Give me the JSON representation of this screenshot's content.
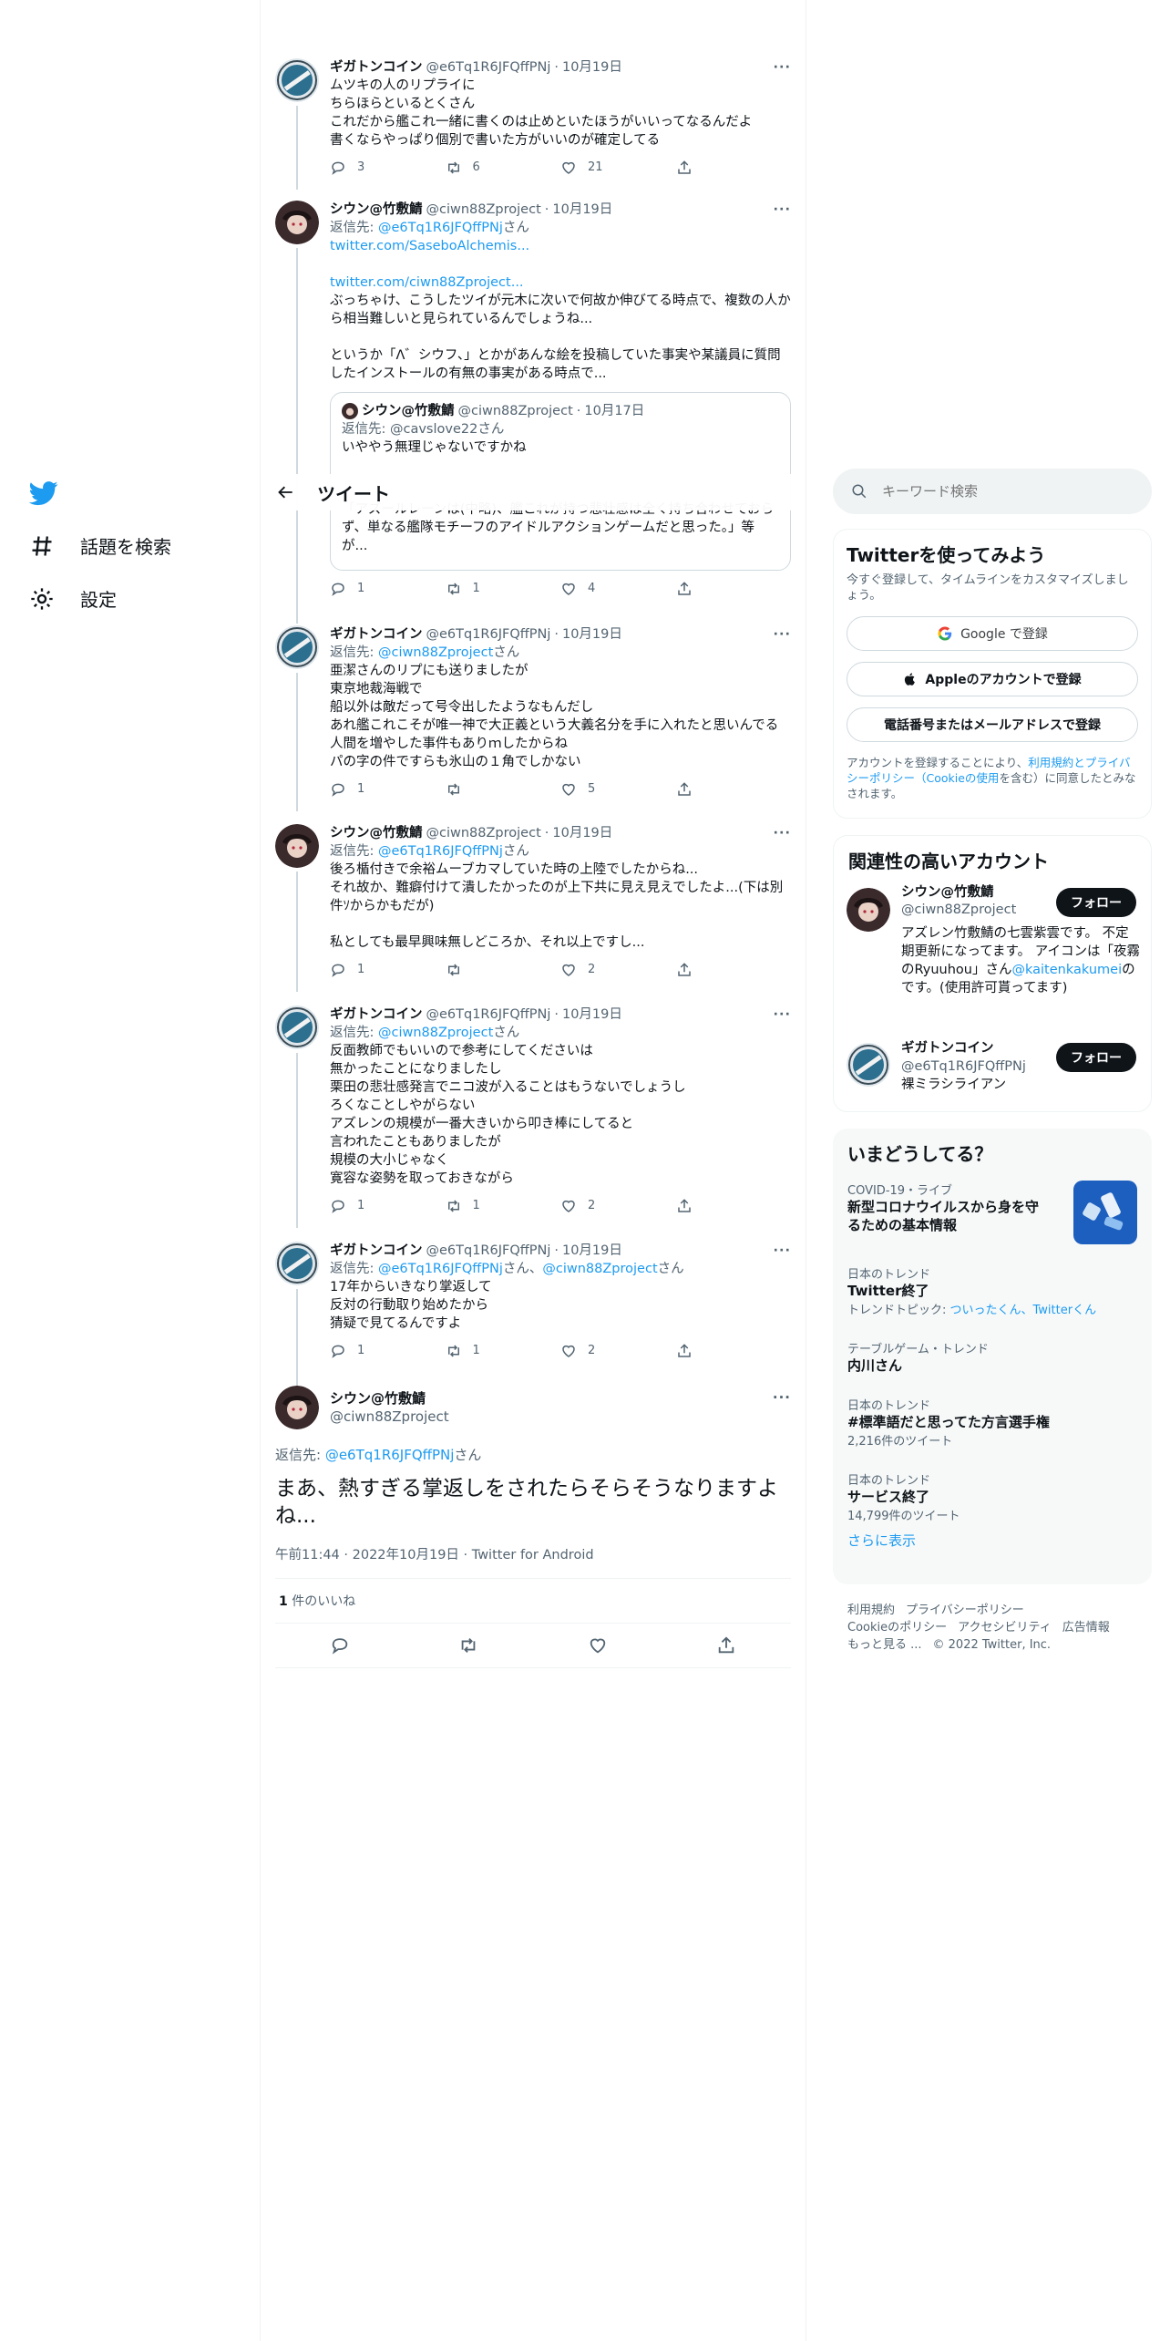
{
  "nav": {
    "explore_label": "話題を検索",
    "settings_label": "設定"
  },
  "header": {
    "title": "ツイート"
  },
  "tweets": [
    {
      "name": "ギガトンコイン",
      "handle": "@e6Tq1R6JFQffPNj",
      "date": "10月19日",
      "reply_to": "",
      "text": "ムツキの人のリプライに\nちらほらといるとくさん\nこれだから艦これ一緒に書くのは止めといたほうがいいってなるんだよ\n書くならやっぱり個別で書いた方がいいのが確定してる",
      "replies": "3",
      "retweets": "6",
      "likes": "21"
    },
    {
      "name": "シウン@竹敷鯖",
      "handle": "@ciwn88Zproject",
      "date": "10月19日",
      "reply_prefix": "返信先: ",
      "reply_to": "@e6Tq1R6JFQffPNj",
      "reply_suffix": "さん",
      "link1": "twitter.com/SaseboAlchemis...",
      "link2": "twitter.com/ciwn88Zproject...",
      "text": "ぶっちゃけ、こうしたツイが元木に次いで何故か伸びてる時点で、複数の人から相当難しいと見られているんでしょうね...\n\nというか「Λ゛シウフ、」とかがあんな絵を投稿していた事実や某議員に質問したインストールの有無の事実がある時点で...",
      "quote": {
        "name": "シウン@竹敷鯖",
        "handle": "@ciwn88Zproject",
        "date": "10月17日",
        "reply": "返信先: @cavslove22さん",
        "text_top": "いややう無理じゃないですかね",
        "text_bottom": "「アズールレーンは(中略)、艦これが持つ悲壮感は全く持ち合わせておらず、単なる艦隊モチーフのアイドルアクションゲームだと思った。」等が..."
      },
      "replies": "1",
      "retweets": "1",
      "likes": "4"
    },
    {
      "name": "ギガトンコイン",
      "handle": "@e6Tq1R6JFQffPNj",
      "date": "10月19日",
      "reply_prefix": "返信先: ",
      "reply_to": "@ciwn88Zproject",
      "reply_suffix": "さん",
      "text": "亜潔さんのリプにも送りましたが\n東京地裁海戦で\n船以外は敵だって号令出したようなもんだし\nあれ艦これこそが唯一神で大正義という大義名分を手に入れたと思いんでる人間を増やした事件もありｍしたからね\nパの字の件ですらも氷山の１角でしかない",
      "replies": "1",
      "retweets": "",
      "likes": "5"
    },
    {
      "name": "シウン@竹敷鯖",
      "handle": "@ciwn88Zproject",
      "date": "10月19日",
      "reply_prefix": "返信先: ",
      "reply_to": "@e6Tq1R6JFQffPNj",
      "reply_suffix": "さん",
      "text": "後ろ楯付きで余裕ムーブカマしていた時の上陸でしたからね...\nそれ故か、難癖付けて潰したかったのが上下共に見え見えでしたよ...(下は別件ｿからかもだが)\n\n私としても最早興味無しどころか、それ以上ですし...",
      "replies": "1",
      "retweets": "",
      "likes": "2"
    },
    {
      "name": "ギガトンコイン",
      "handle": "@e6Tq1R6JFQffPNj",
      "date": "10月19日",
      "reply_prefix": "返信先: ",
      "reply_to": "@ciwn88Zproject",
      "reply_suffix": "さん",
      "text": "反面教師でもいいので参考にしてくださいは\n無かったことになりましたし\n栗田の悲壮感発言でニコ波が入ることはもうないでしょうし\nろくなことしやがらない\nアズレンの規模が一番大きいから叩き棒にしてると\n言われたこともありましたが\n規模の大小じゃなく\n寛容な姿勢を取っておきながら",
      "replies": "1",
      "retweets": "1",
      "likes": "2"
    },
    {
      "name": "ギガトンコイン",
      "handle": "@e6Tq1R6JFQffPNj",
      "date": "10月19日",
      "reply_prefix": "返信先: ",
      "reply_to": "@e6Tq1R6JFQffPNj",
      "reply_and": "さん、",
      "reply_to2": "@ciwn88Zproject",
      "reply_suffix": "さん",
      "text": "17年からいきなり掌返して\n反対の行動取り始めたから\n猜疑で見てるんですよ",
      "replies": "1",
      "retweets": "1",
      "likes": "2"
    }
  ],
  "main_tweet": {
    "name": "シウン@竹敷鯖",
    "handle": "@ciwn88Zproject",
    "reply_prefix": "返信先: ",
    "reply_to": "@e6Tq1R6JFQffPNj",
    "reply_suffix": "さん",
    "text": "まあ、熱すぎる掌返しをされたらそらそうなりますよね...",
    "timestamp": "午前11:44 · 2022年10月19日 · Twitter for Android",
    "like_count": "1",
    "like_label": "件のいいね"
  },
  "search": {
    "placeholder": "キーワード検索"
  },
  "signup": {
    "title": "Twitterを使ってみよう",
    "subtitle": "今すぐ登録して、タイムラインをカスタマイズしましょう。",
    "google": "Google で登録",
    "apple": "Appleのアカウントで登録",
    "phone": "電話番号またはメールアドレスで登録",
    "terms_pre": "アカウントを登録することにより、",
    "terms_link": "利用規約とプライバシーポリシー（Cookieの使用",
    "terms_post": "を含む）に同意したとみなされます。"
  },
  "related": {
    "title": "関連性の高いアカウント",
    "follow_label": "フォロー",
    "accounts": [
      {
        "name": "シウン@竹敷鯖",
        "handle": "@ciwn88Zproject",
        "bio": "アズレン竹敷鯖の七雲紫雲です。 不定期更新になってます。 アイコンは「夜霧のRyuuhou」さん",
        "bio_link": "@kaitenkakumei",
        "bio_end": "のです。(使用許可貰ってます)"
      },
      {
        "name": "ギガトンコイン",
        "handle": "@e6Tq1R6JFQffPNj",
        "bio": "裸ミラシライアン"
      }
    ]
  },
  "trends": {
    "title": "いまどうしてる？",
    "items": [
      {
        "meta": "COVID-19・ライブ",
        "name": "新型コロナウイルスから身を守るための基本情報",
        "sub": ""
      },
      {
        "meta": "日本のトレンド",
        "name": "Twitter終了",
        "sub_pre": "トレンドトピック: ",
        "sub": "ついったくん、Twitterくん"
      },
      {
        "meta": "テーブルゲーム・トレンド",
        "name": "内川さん",
        "sub": ""
      },
      {
        "meta": "日本のトレンド",
        "name": "#標準語だと思ってた方言選手権",
        "count": "2,216件のツイート"
      },
      {
        "meta": "日本のトレンド",
        "name": "サービス終了",
        "count": "14,799件のツイート"
      }
    ],
    "more": "さらに表示"
  },
  "footer": {
    "links": [
      "利用規約",
      "プライバシーポリシー",
      "Cookieのポリシー",
      "アクセシビリティ",
      "広告情報",
      "もっと見る ..."
    ],
    "copyright": "© 2022 Twitter, Inc."
  },
  "colors": {
    "accent": "#1d9bf0",
    "text": "#0f1419",
    "muted": "#536471",
    "border": "#eff3f4"
  }
}
